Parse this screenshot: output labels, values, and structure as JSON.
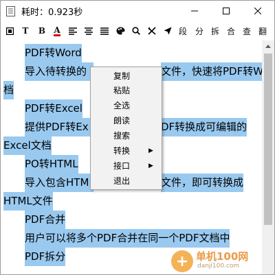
{
  "window": {
    "title": "耗时：0.923秒"
  },
  "toolbar": {
    "buttons": [
      {
        "icon": "stop-icon",
        "label": ""
      },
      {
        "icon": "text-icon",
        "label": "T"
      },
      {
        "icon": "bold-icon",
        "label": "B"
      },
      {
        "icon": "font-color-icon",
        "label": "A"
      },
      {
        "icon": "align-left-icon",
        "label": ""
      },
      {
        "icon": "align-center-icon",
        "label": ""
      },
      {
        "icon": "align-right-icon",
        "label": ""
      },
      {
        "icon": "palette-icon",
        "label": ""
      },
      {
        "icon": "search-icon",
        "label": ""
      },
      {
        "icon": "cut-icon",
        "label": ""
      },
      {
        "icon": "send-icon",
        "label": ""
      }
    ],
    "text_buttons": [
      "段",
      "分",
      "拆",
      "合",
      "查",
      "翻"
    ]
  },
  "content": {
    "lines": [
      "PDF转Word",
      "导入待转换的",
      "档",
      "PDF转Excel",
      "提供PDF转Ex",
      "Excel文档",
      "PO转HTML",
      "导入包含HTM",
      "HTML文件",
      "PDF合并",
      "用户可以将多个PDF合并在同一个PDF文档中",
      "PDF拆分"
    ],
    "right_fragments": [
      "文件，快速将PDF转Word文",
      "DF转换成可编辑的",
      "文件，即可转换成"
    ]
  },
  "context_menu": {
    "items": [
      {
        "label": "复制",
        "submenu": false
      },
      {
        "label": "粘贴",
        "submenu": false
      },
      {
        "label": "全选",
        "submenu": false
      },
      {
        "label": "朗读",
        "submenu": false
      },
      {
        "label": "搜索",
        "submenu": false
      },
      {
        "label": "转换",
        "submenu": true
      },
      {
        "label": "接口",
        "submenu": true
      },
      {
        "label": "退出",
        "submenu": false
      }
    ]
  },
  "watermark": {
    "brand": "单机100网",
    "url": "danji100.com"
  },
  "colors": {
    "selection": "#99c9ef",
    "menu_bg": "#f2f2f2"
  }
}
